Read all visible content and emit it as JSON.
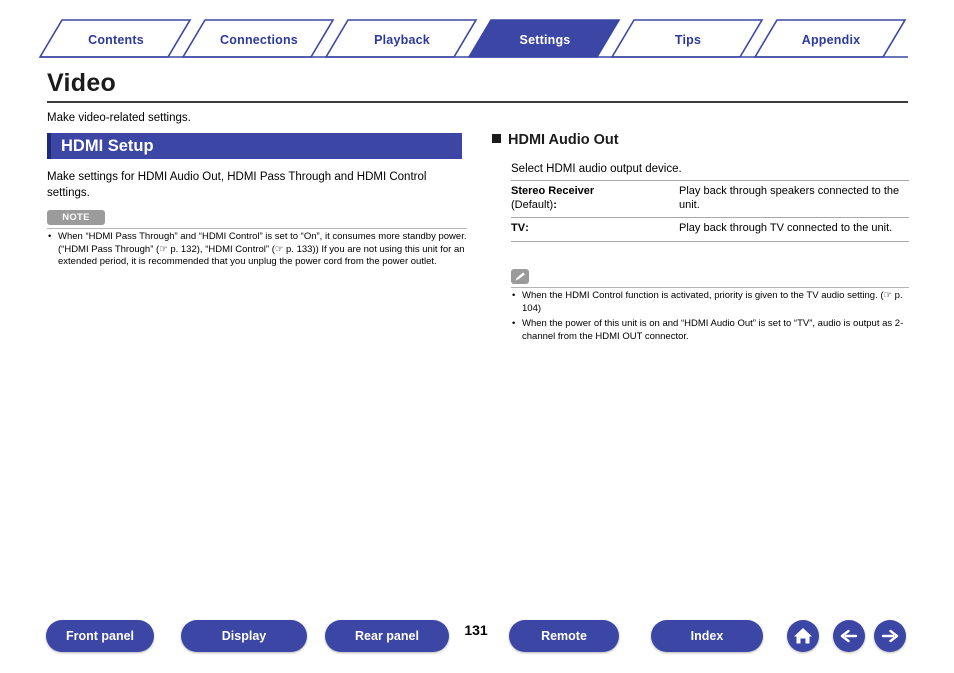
{
  "tabs": [
    {
      "label": "Contents",
      "active": false
    },
    {
      "label": "Connections",
      "active": false
    },
    {
      "label": "Playback",
      "active": false
    },
    {
      "label": "Settings",
      "active": true
    },
    {
      "label": "Tips",
      "active": false
    },
    {
      "label": "Appendix",
      "active": false
    }
  ],
  "page": {
    "title": "Video",
    "intro": "Make video-related settings."
  },
  "left": {
    "section_title": "HDMI Setup",
    "paragraph": "Make settings for HDMI Audio Out, HDMI Pass Through and HDMI Control settings.",
    "note_label": "NOTE",
    "notes": [
      "When “HDMI Pass Through” and “HDMI Control” is set to “On”, it consumes more standby power. (“HDMI Pass Through” (☞ p. 132), “HDMI Control” (☞ p. 133)) If you are not using this unit for an extended period, it is recommended that you unplug the power cord from the power outlet."
    ]
  },
  "right": {
    "sub_heading": "HDMI Audio Out",
    "description": "Select HDMI audio output device.",
    "table": {
      "rows": [
        {
          "name": "Stereo Receiver",
          "default": "(Default)",
          "desc": "Play back through speakers connected to the unit."
        },
        {
          "name": "TV",
          "default": "",
          "desc": "Play back through TV connected to the unit."
        }
      ]
    },
    "tips": [
      "When the HDMI Control function is activated, priority is given to the TV audio setting.  (☞ p. 104)",
      "When the power of this unit is on and “HDMI Audio Out” is set to “TV”, audio is output as 2-channel from the HDMI OUT connector."
    ]
  },
  "footer": {
    "buttons": [
      {
        "label": "Front panel"
      },
      {
        "label": "Display"
      },
      {
        "label": "Rear panel"
      },
      {
        "label": "Remote"
      },
      {
        "label": "Index"
      }
    ],
    "page_number": "131",
    "icons": [
      {
        "name": "home-icon"
      },
      {
        "name": "arrow-left-icon"
      },
      {
        "name": "arrow-right-icon"
      }
    ]
  },
  "colors": {
    "accent": "#3b46a5",
    "accent_dark": "#1d2a7a",
    "note_gray": "#9b9b9b"
  }
}
